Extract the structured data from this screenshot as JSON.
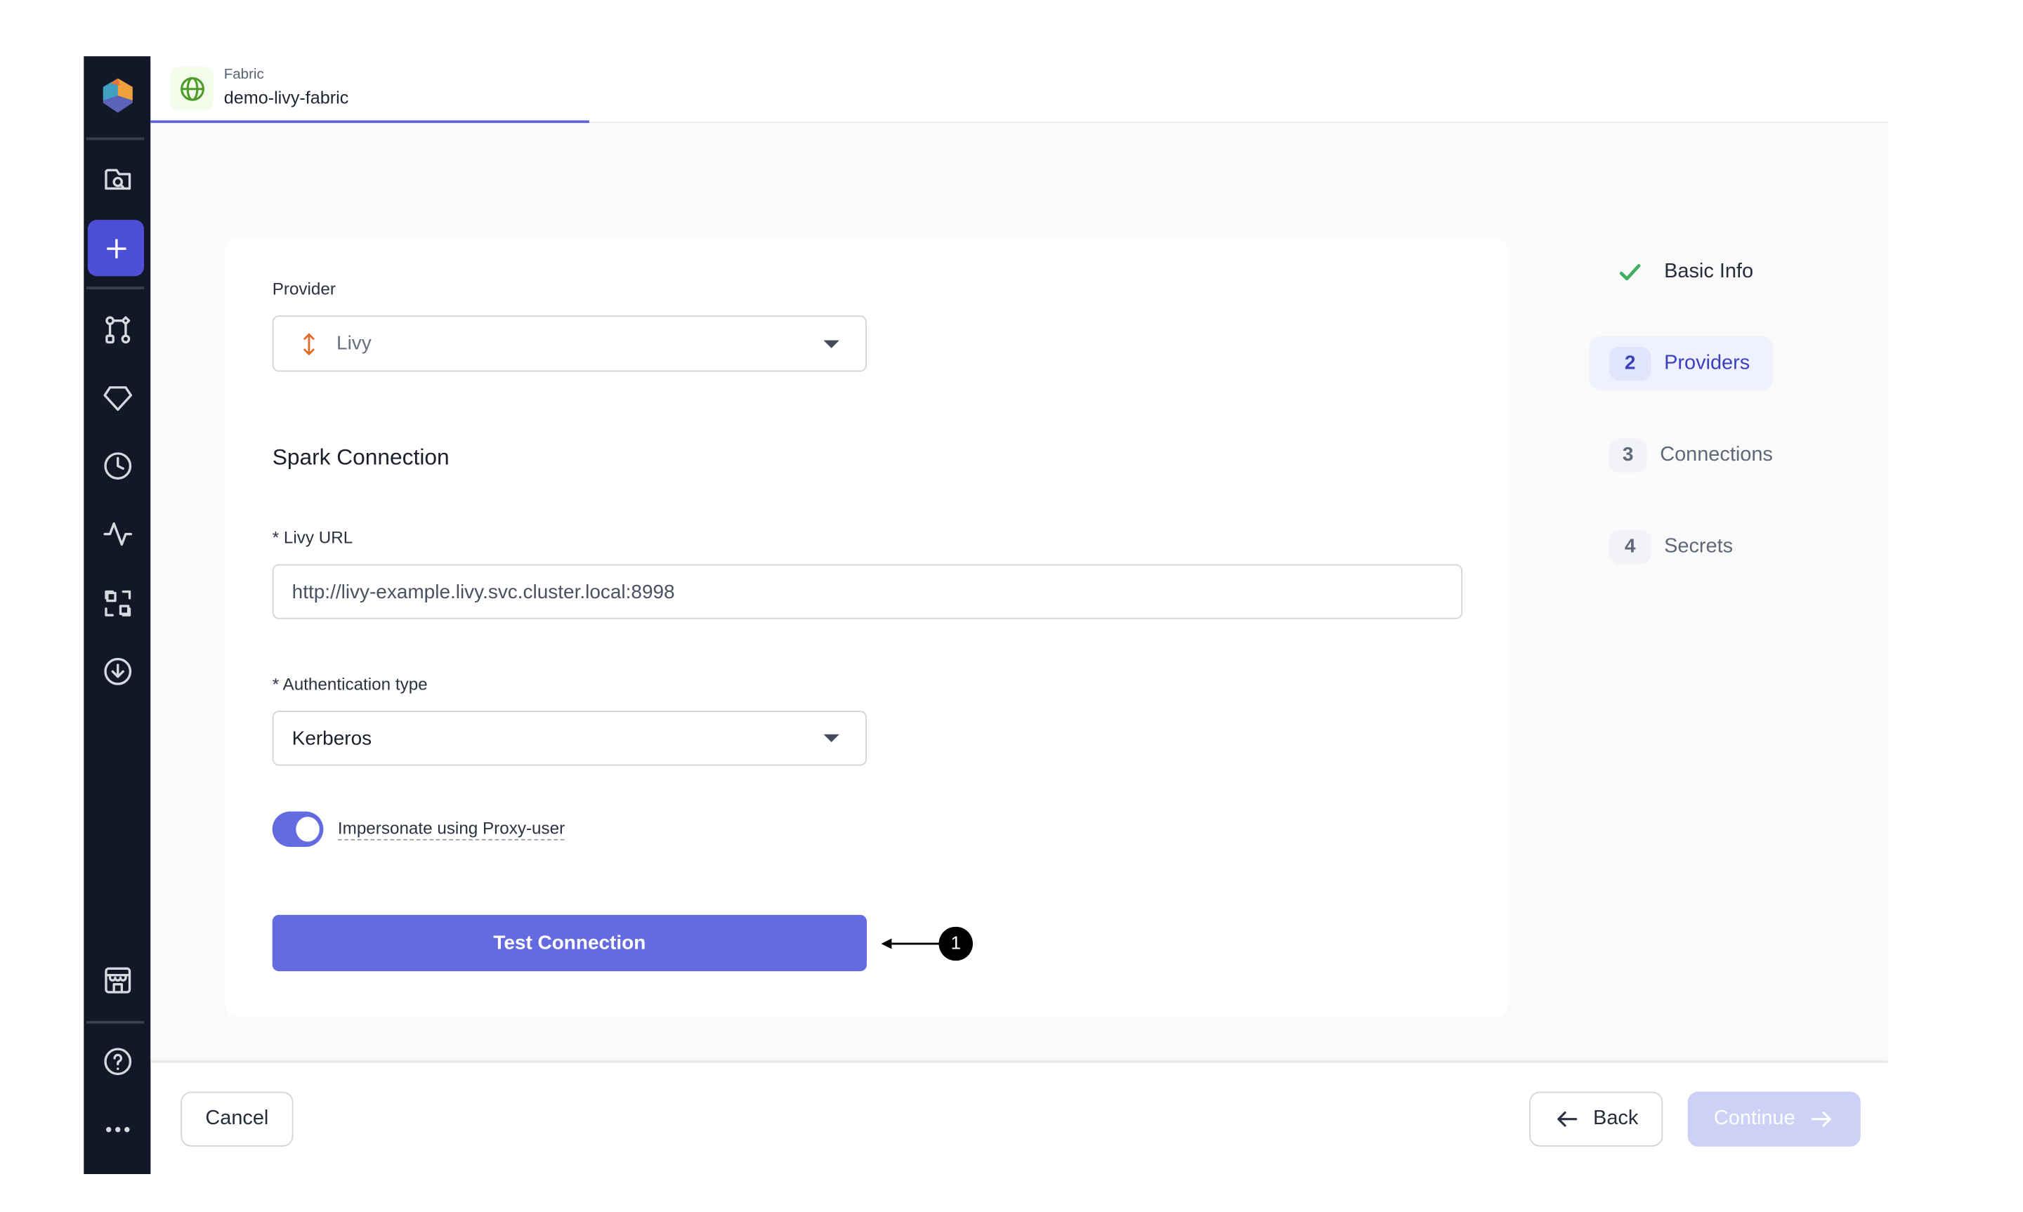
{
  "header": {
    "breadcrumb_type": "Fabric",
    "title": "demo-livy-fabric"
  },
  "form": {
    "provider_label": "Provider",
    "provider_value": "Livy",
    "section_title": "Spark Connection",
    "livy_url_label": "* Livy URL",
    "livy_url_value": "http://livy-example.livy.svc.cluster.local:8998",
    "auth_label": "* Authentication type",
    "auth_value": "Kerberos",
    "toggle_label": "Impersonate using Proxy-user",
    "toggle_on": true,
    "test_button": "Test Connection",
    "annotation_number": "1"
  },
  "steps": [
    {
      "badge": "",
      "label": "Basic Info",
      "status": "done"
    },
    {
      "badge": "2",
      "label": "Providers",
      "status": "active"
    },
    {
      "badge": "3",
      "label": "Connections",
      "status": "pending"
    },
    {
      "badge": "4",
      "label": "Secrets",
      "status": "pending"
    }
  ],
  "footer": {
    "cancel": "Cancel",
    "back": "Back",
    "continue": "Continue"
  },
  "colors": {
    "accent": "#646ae0",
    "sidebar": "#131828",
    "success": "#3fae5f",
    "provider_icon": "#e06a27"
  }
}
